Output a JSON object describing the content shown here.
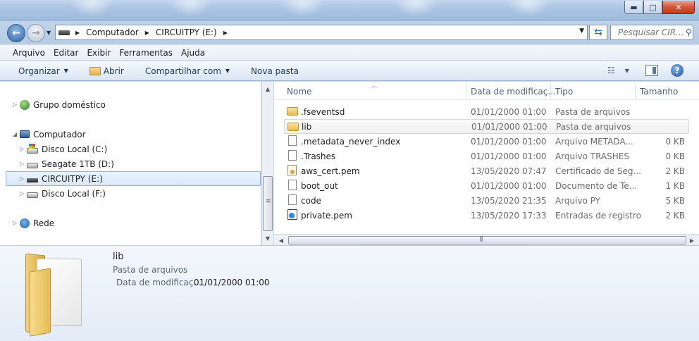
{
  "window": {
    "controls": {
      "minimize": "▬",
      "maximize": "□",
      "close": "✕"
    }
  },
  "address": {
    "crumbs": [
      "Computador",
      "CIRCUITPY (E:)"
    ],
    "search_placeholder": "Pesquisar CIR..."
  },
  "menu": [
    "Arquivo",
    "Editar",
    "Exibir",
    "Ferramentas",
    "Ajuda"
  ],
  "commands": {
    "organize": "Organizar",
    "open": "Abrir",
    "share": "Compartilhar com",
    "new_folder": "Nova pasta",
    "help": "?"
  },
  "nav": {
    "homegroup": "Grupo doméstico",
    "computer": "Computador",
    "drives": [
      "Disco Local (C:)",
      "Seagate 1TB (D:)",
      "CIRCUITPY (E:)",
      "Disco Local (F:)"
    ],
    "network": "Rede"
  },
  "columns": {
    "name": "Nome",
    "date": "Data de modificaç...",
    "type": "Tipo",
    "size": "Tamanho"
  },
  "files": [
    {
      "name": ".fseventsd",
      "date": "01/01/2000 01:00",
      "type": "Pasta de arquivos",
      "size": "",
      "icon": "folder-icon"
    },
    {
      "name": "lib",
      "date": "01/01/2000 01:00",
      "type": "Pasta de arquivos",
      "size": "",
      "icon": "folder-icon"
    },
    {
      "name": ".metadata_never_index",
      "date": "01/01/2000 01:00",
      "type": "Arquivo METADA...",
      "size": "0 KB",
      "icon": "file-icon"
    },
    {
      "name": ".Trashes",
      "date": "01/01/2000 01:00",
      "type": "Arquivo TRASHES",
      "size": "0 KB",
      "icon": "file-icon"
    },
    {
      "name": "aws_cert.pem",
      "date": "13/05/2020 07:47",
      "type": "Certificado de Seg...",
      "size": "2 KB",
      "icon": "certificate-icon"
    },
    {
      "name": "boot_out",
      "date": "01/01/2000 01:00",
      "type": "Documento de Te...",
      "size": "1 KB",
      "icon": "text-file-icon"
    },
    {
      "name": "code",
      "date": "13/05/2020 21:35",
      "type": "Arquivo PY",
      "size": "5 KB",
      "icon": "file-icon"
    },
    {
      "name": "private.pem",
      "date": "13/05/2020 17:33",
      "type": "Entradas de registro",
      "size": "2 KB",
      "icon": "registry-icon"
    }
  ],
  "details": {
    "name": "lib",
    "type": "Pasta de arquivos",
    "date_label": "Data de modificaç...",
    "date_value": "01/01/2000 01:00"
  },
  "colors": {
    "selection_border": "#8fb4de",
    "accent": "#2c64a8"
  }
}
